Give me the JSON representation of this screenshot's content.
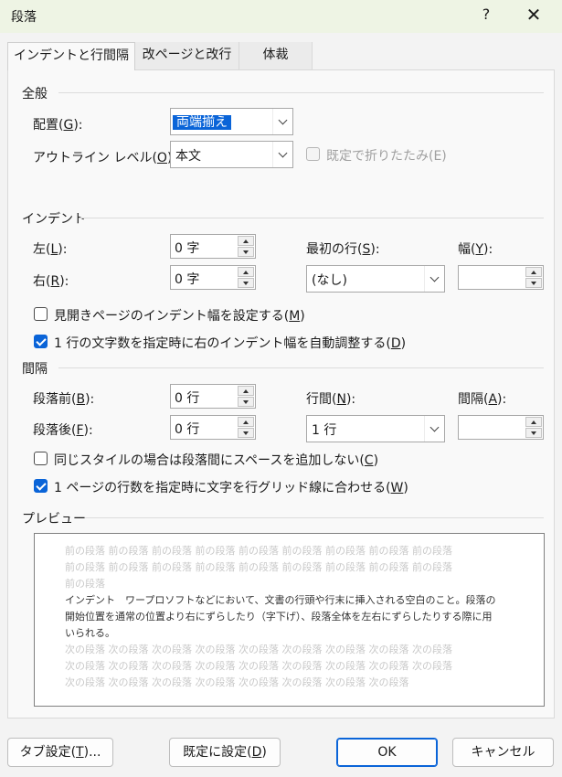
{
  "window": {
    "title": "段落",
    "help": "?",
    "close": "✕"
  },
  "tabs": [
    {
      "label": "インデントと行間隔",
      "active": true
    },
    {
      "label": "改ページと改行",
      "active": false
    },
    {
      "label": "体裁",
      "active": false
    }
  ],
  "general": {
    "heading": "全般",
    "alignment": {
      "label": "配置(",
      "key": "G",
      "suffix": "):",
      "value": "両端揃え"
    },
    "outline": {
      "label": "アウトライン レベル(",
      "key": "O",
      "suffix": "):",
      "value": "本文"
    },
    "collapsed": {
      "label": "既定で折りたたみ(E)",
      "checked": false,
      "disabled": true
    }
  },
  "indent": {
    "heading": "インデント",
    "left": {
      "label": "左(",
      "key": "L",
      "suffix": "):",
      "value": "0 字"
    },
    "right": {
      "label": "右(",
      "key": "R",
      "suffix": "):",
      "value": "0 字"
    },
    "first_line": {
      "label": "最初の行(",
      "key": "S",
      "suffix": "):",
      "value": "(なし)"
    },
    "by": {
      "label": "幅(",
      "key": "Y",
      "suffix": "):",
      "value": ""
    },
    "mirror": {
      "label": "見開きページのインデント幅を設定する(",
      "key": "M",
      "suffix": ")",
      "checked": false
    },
    "auto_adjust": {
      "label": "1 行の文字数を指定時に右のインデント幅を自動調整する(",
      "key": "D",
      "suffix": ")",
      "checked": true
    }
  },
  "spacing": {
    "heading": "間隔",
    "before": {
      "label": "段落前(",
      "key": "B",
      "suffix": "):",
      "value": "0 行"
    },
    "after": {
      "label": "段落後(",
      "key": "F",
      "suffix": "):",
      "value": "0 行"
    },
    "line_spacing": {
      "label": "行間(",
      "key": "N",
      "suffix": "):",
      "value": "1 行"
    },
    "at": {
      "label": "間隔(",
      "key": "A",
      "suffix": "):",
      "value": ""
    },
    "dont_add_space": {
      "label": "同じスタイルの場合は段落間にスペースを追加しない(",
      "key": "C",
      "suffix": ")",
      "checked": false
    },
    "snap_grid": {
      "label": "1 ページの行数を指定時に文字を行グリッド線に合わせる(",
      "key": "W",
      "suffix": ")",
      "checked": true
    }
  },
  "preview": {
    "heading": "プレビュー",
    "prev_lines": [
      "前の段落 前の段落 前の段落 前の段落 前の段落 前の段落 前の段落 前の段落 前の段落",
      "前の段落 前の段落 前の段落 前の段落 前の段落 前の段落 前の段落 前の段落 前の段落",
      "前の段落"
    ],
    "main_lines": [
      "インデント　ワープロソフトなどにおいて、文書の行頭や行末に挿入される空白のこと。段落の",
      "開始位置を通常の位置より右にずらしたり（字下げ）、段落全体を左右にずらしたりする際に用",
      "いられる。"
    ],
    "next_lines": [
      "次の段落 次の段落 次の段落 次の段落 次の段落 次の段落 次の段落 次の段落 次の段落",
      "次の段落 次の段落 次の段落 次の段落 次の段落 次の段落 次の段落 次の段落 次の段落",
      "次の段落 次の段落 次の段落 次の段落 次の段落 次の段落 次の段落 次の段落"
    ]
  },
  "buttons": {
    "tabs": {
      "label": "タブ設定(",
      "key": "T",
      "suffix": ")..."
    },
    "set_default": {
      "label": "既定に設定(",
      "key": "D",
      "suffix": ")"
    },
    "ok": "OK",
    "cancel": "キャンセル"
  }
}
